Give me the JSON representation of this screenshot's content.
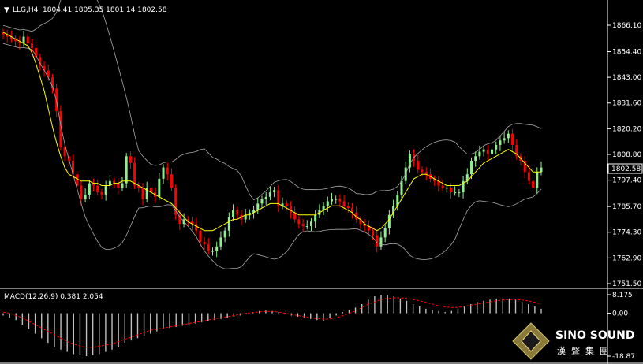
{
  "header": {
    "arrow": "▼",
    "symbol": "LLG,H4",
    "ohlc": "1804.41 1805.35 1801.14 1802.58"
  },
  "macd_header": "MACD(12,26,9) 0.381 2.054",
  "logo": {
    "name": "SINO SOUND",
    "sub": "漢聲集團"
  },
  "current_price": "1802.58",
  "colors": {
    "background": "#000000",
    "bull": "#90ee90",
    "bear": "#ff0000",
    "ma": "#ffff00",
    "bands": "#a9a9a9",
    "macd_hist": "#c0c0c0",
    "macd_signal": "#ff0000"
  },
  "chart_data": [
    {
      "type": "candlestick",
      "title": "LLG,H4",
      "y_ticks": [
        "1866.10",
        "1854.40",
        "1843.00",
        "1831.60",
        "1820.20",
        "1808.80",
        "1797.40",
        "1785.70",
        "1774.30",
        "1762.90",
        "1751.50"
      ],
      "ylim": [
        1751.5,
        1866.1
      ],
      "series": [
        {
          "name": "close",
          "values": [
            1862,
            1861,
            1860,
            1859,
            1858,
            1861,
            1858,
            1856,
            1852,
            1848,
            1846,
            1843,
            1838,
            1828,
            1812,
            1808,
            1806,
            1800,
            1795,
            1789,
            1791,
            1796,
            1795,
            1792,
            1791,
            1795,
            1797,
            1796,
            1794,
            1796,
            1808,
            1805,
            1795,
            1794,
            1789,
            1794,
            1792,
            1790,
            1798,
            1803,
            1800,
            1794,
            1782,
            1778,
            1780,
            1779,
            1778,
            1775,
            1770,
            1769,
            1766,
            1766,
            1768,
            1772,
            1775,
            1781,
            1784,
            1782,
            1780,
            1782,
            1783,
            1784,
            1787,
            1789,
            1790,
            1792,
            1793,
            1786,
            1787,
            1786,
            1783,
            1780,
            1778,
            1777,
            1777,
            1779,
            1782,
            1784,
            1786,
            1788,
            1789,
            1789,
            1788,
            1786,
            1785,
            1783,
            1780,
            1778,
            1777,
            1775,
            1773,
            1768,
            1772,
            1776,
            1782,
            1786,
            1791,
            1797,
            1803,
            1809,
            1806,
            1802,
            1801,
            1800,
            1798,
            1797,
            1795,
            1794,
            1794,
            1792,
            1792,
            1792,
            1797,
            1800,
            1806,
            1808,
            1810,
            1811,
            1809,
            1811,
            1813,
            1815,
            1816,
            1818,
            1813,
            1808,
            1806,
            1801,
            1797,
            1794,
            1801,
            1803
          ]
        },
        {
          "name": "moving-average",
          "values": [
            1863,
            1862,
            1861,
            1860,
            1859,
            1858,
            1857,
            1854,
            1849,
            1843,
            1837,
            1829,
            1821,
            1814,
            1808,
            1803,
            1800,
            1799,
            1798,
            1797,
            1797,
            1797,
            1796,
            1796,
            1795,
            1795,
            1795,
            1796,
            1796,
            1797,
            1797,
            1797,
            1796,
            1795,
            1794,
            1793,
            1792,
            1791,
            1790,
            1789,
            1788,
            1787,
            1785,
            1783,
            1781,
            1779,
            1778,
            1777,
            1776,
            1775,
            1775,
            1775,
            1776,
            1777,
            1778,
            1779,
            1780,
            1780,
            1781,
            1782,
            1782,
            1783,
            1784,
            1785,
            1786,
            1787,
            1787,
            1787,
            1786,
            1785,
            1784,
            1783,
            1782,
            1782,
            1782,
            1782,
            1782,
            1783,
            1784,
            1785,
            1786,
            1786,
            1786,
            1785,
            1784,
            1783,
            1781,
            1780,
            1778,
            1777,
            1776,
            1775,
            1776,
            1778,
            1780,
            1783,
            1786,
            1789,
            1792,
            1795,
            1798,
            1799,
            1800,
            1800,
            1799,
            1798,
            1797,
            1796,
            1795,
            1795,
            1795,
            1795,
            1796,
            1797,
            1799,
            1801,
            1803,
            1805,
            1806,
            1807,
            1808,
            1809,
            1810,
            1811,
            1810,
            1809,
            1807,
            1805,
            1803,
            1801,
            1801,
            1801
          ]
        }
      ],
      "current_price": 1802.58
    },
    {
      "type": "bar",
      "title": "MACD(12,26,9)",
      "y_ticks": [
        "8.175",
        "0.00",
        "-18.87"
      ],
      "ylim": [
        -18.87,
        8.175
      ],
      "series": [
        {
          "name": "histogram",
          "values": [
            -1,
            -2,
            -3,
            -5,
            -7,
            -9,
            -11,
            -13,
            -15,
            -16,
            -17,
            -18,
            -18.5,
            -18.87,
            -18.5,
            -18,
            -17,
            -16,
            -15,
            -13,
            -12,
            -11,
            -10,
            -9,
            -8,
            -7,
            -6.5,
            -6,
            -5.5,
            -5,
            -4.5,
            -4,
            -3.5,
            -3,
            -2.5,
            -2,
            -1.5,
            -1,
            -0.5,
            0.5,
            1,
            1.2,
            1,
            0.5,
            -0.5,
            -1,
            -1.5,
            -2,
            -2.5,
            -3,
            -3.5,
            -2,
            -1,
            0.5,
            1.5,
            2.5,
            4,
            6,
            7.5,
            8.175,
            8,
            7.5,
            6.5,
            5.5,
            4,
            3,
            2,
            1.5,
            1,
            0.5,
            1,
            2,
            3,
            4,
            5,
            5.5,
            6,
            6.5,
            6.5,
            6.5,
            6,
            5,
            4,
            3,
            2
          ]
        },
        {
          "name": "signal",
          "values": [
            0.5,
            0,
            -1,
            -2,
            -3.5,
            -5,
            -6.5,
            -8,
            -9.5,
            -11,
            -12.5,
            -13.5,
            -14.5,
            -15,
            -15,
            -14.5,
            -14,
            -13.5,
            -12.5,
            -11.5,
            -10.5,
            -9.5,
            -8.5,
            -7.5,
            -7,
            -6.5,
            -6,
            -5.5,
            -5,
            -4.5,
            -4,
            -3.5,
            -3,
            -2.5,
            -2,
            -1.5,
            -1,
            -0.5,
            0,
            0.3,
            0.6,
            0.8,
            0.8,
            0.5,
            0,
            -0.5,
            -1,
            -1.5,
            -2,
            -2.4,
            -2.6,
            -2.5,
            -2,
            -1,
            0,
            1,
            2.5,
            4,
            5,
            6,
            6.5,
            6.8,
            6.8,
            6.5,
            6,
            5.5,
            4.8,
            4,
            3.3,
            2.8,
            2.5,
            2.6,
            3,
            3.5,
            4,
            4.5,
            5,
            5.5,
            5.8,
            6,
            6,
            5.8,
            5.4,
            4.8,
            4
          ]
        }
      ]
    }
  ]
}
